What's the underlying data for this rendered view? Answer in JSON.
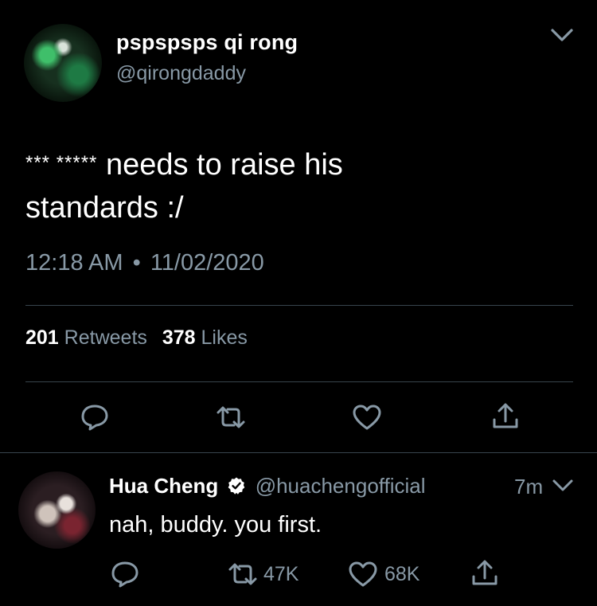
{
  "tweet": {
    "display_name": "pspspsps qi rong",
    "handle": "@qirongdaddy",
    "text_line1_censored": "*** *****",
    "text_line1_rest": "needs to raise his",
    "text_line2": "standards :/",
    "time": "12:18 AM",
    "separator": "•",
    "date": "11/02/2020",
    "retweets_count": "201",
    "retweets_label": "Retweets",
    "likes_count": "378",
    "likes_label": "Likes"
  },
  "reply": {
    "display_name": "Hua Cheng",
    "handle": "@huachengofficial",
    "age": "7m",
    "text": "nah, buddy. you first.",
    "retweet_count": "47K",
    "like_count": "68K"
  },
  "icons": {
    "caret": "chevron-down-icon",
    "reply": "reply-icon",
    "retweet": "retweet-icon",
    "like": "heart-icon",
    "share": "share-icon",
    "verified": "verified-badge-icon"
  },
  "colors": {
    "background": "#000000",
    "text": "#ffffff",
    "muted": "#8899a6",
    "divider": "#38444d"
  }
}
